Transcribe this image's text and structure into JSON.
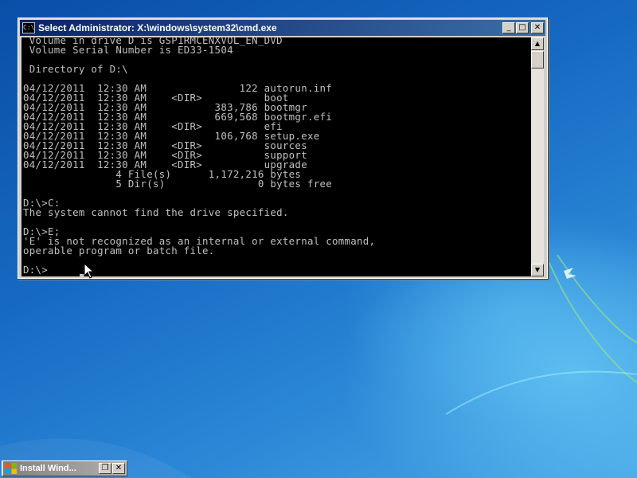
{
  "window": {
    "title": "Select Administrator: X:\\windows\\system32\\cmd.exe",
    "icon_text": "C:\\",
    "minimize_symbol": "_",
    "maximize_symbol": "□",
    "close_symbol": "✕"
  },
  "console": {
    "lines": [
      " Volume in drive D is GSP1RMCENXVOL_EN_DVD",
      " Volume Serial Number is ED33-1504",
      "",
      " Directory of D:\\",
      "",
      "04/12/2011  12:30 AM               122 autorun.inf",
      "04/12/2011  12:30 AM    <DIR>          boot",
      "04/12/2011  12:30 AM           383,786 bootmgr",
      "04/12/2011  12:30 AM           669,568 bootmgr.efi",
      "04/12/2011  12:30 AM    <DIR>          efi",
      "04/12/2011  12:30 AM           106,768 setup.exe",
      "04/12/2011  12:30 AM    <DIR>          sources",
      "04/12/2011  12:30 AM    <DIR>          support",
      "04/12/2011  12:30 AM    <DIR>          upgrade",
      "               4 File(s)      1,172,216 bytes",
      "               5 Dir(s)               0 bytes free",
      "",
      "D:\\>C:",
      "The system cannot find the drive specified.",
      "",
      "D:\\>E;",
      "'E' is not recognized as an internal or external command,",
      "operable program or batch file.",
      "",
      "D:\\>"
    ]
  },
  "scrollbar": {
    "up_symbol": "▲",
    "down_symbol": "▼"
  },
  "minimized_window": {
    "title": "Install Wind...",
    "restore_symbol": "❐",
    "close_symbol": "✕"
  },
  "colors": {
    "console_bg": "#000000",
    "console_fg": "#c0c0c0",
    "title_active_start": "#0a246a",
    "title_active_end": "#3a6ea5",
    "desktop_blue": "#1669c2"
  }
}
